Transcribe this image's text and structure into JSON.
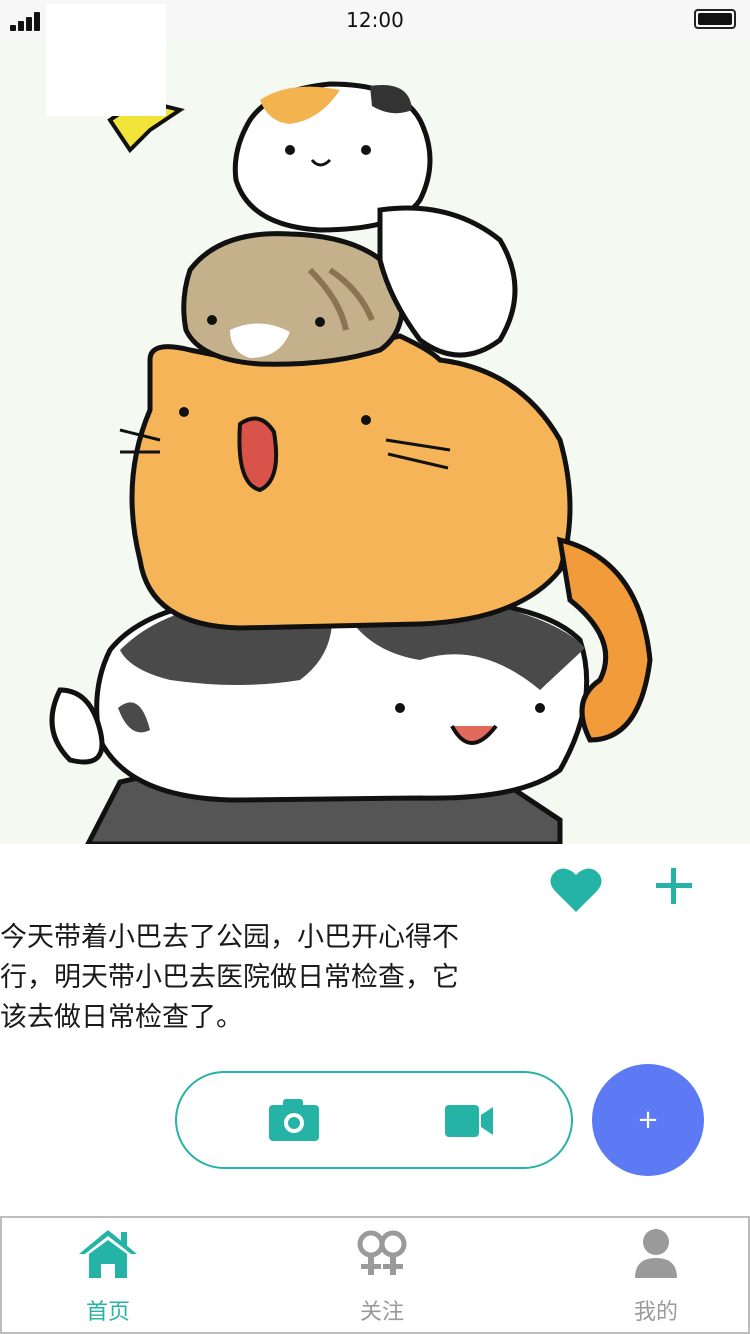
{
  "status_bar": {
    "time": "12:00"
  },
  "post": {
    "image_icon": "stacked-cats-illustration",
    "text": "今天带着小巴去了公园，小巴开心得不行，明天带小巴去医院做日常检查，它该去做日常检查了。"
  },
  "actions": {
    "like_icon": "heart-icon",
    "add_icon": "plus-icon"
  },
  "media": {
    "camera_icon": "camera-icon",
    "video_icon": "video-camera-icon"
  },
  "fab": {
    "label": "+"
  },
  "tabs": [
    {
      "label": "首页",
      "icon": "home-icon",
      "active": true
    },
    {
      "label": "关注",
      "icon": "gender-icon",
      "active": false
    },
    {
      "label": "我的",
      "icon": "user-icon",
      "active": false
    }
  ],
  "colors": {
    "accent": "#25b3a6",
    "fab": "#5b7af4",
    "inactive": "#9a9a9a"
  }
}
